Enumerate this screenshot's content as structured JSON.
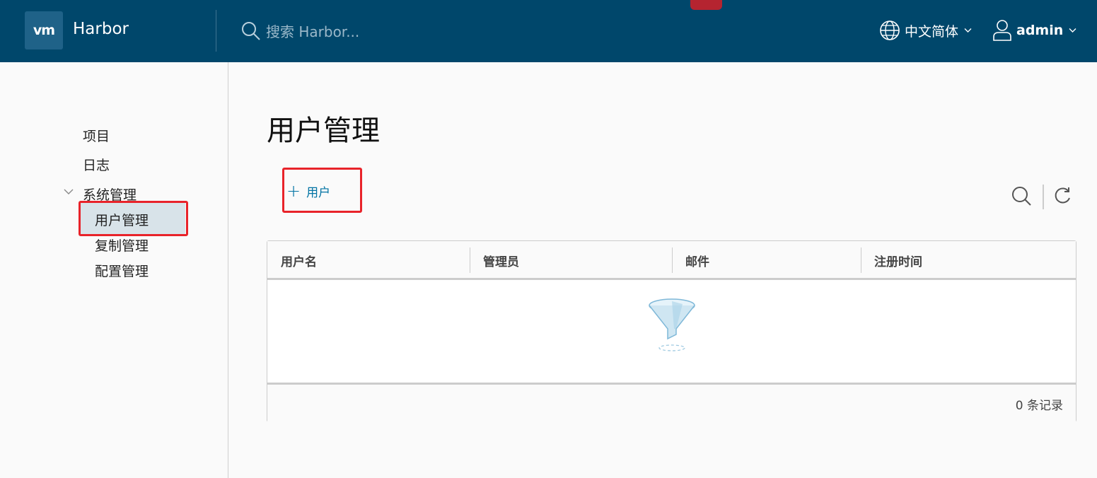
{
  "header": {
    "logo": "vm",
    "app_title": "Harbor",
    "search_placeholder": "搜索 Harbor...",
    "language": "中文简体",
    "username": "admin"
  },
  "sidebar": {
    "items": [
      {
        "label": "项目"
      },
      {
        "label": "日志"
      },
      {
        "label": "系统管理"
      },
      {
        "label": "用户管理"
      },
      {
        "label": "复制管理"
      },
      {
        "label": "配置管理"
      }
    ]
  },
  "main": {
    "title": "用户管理",
    "add_button_label": "用户",
    "table": {
      "columns": [
        "用户名",
        "管理员",
        "邮件",
        "注册时间"
      ],
      "rows": [],
      "footer": "0 条记录"
    }
  },
  "colors": {
    "header_bg": "#00476b",
    "accent": "#0072a3",
    "highlight": "#e8232a",
    "active_nav_bg": "#d8e3e9"
  }
}
